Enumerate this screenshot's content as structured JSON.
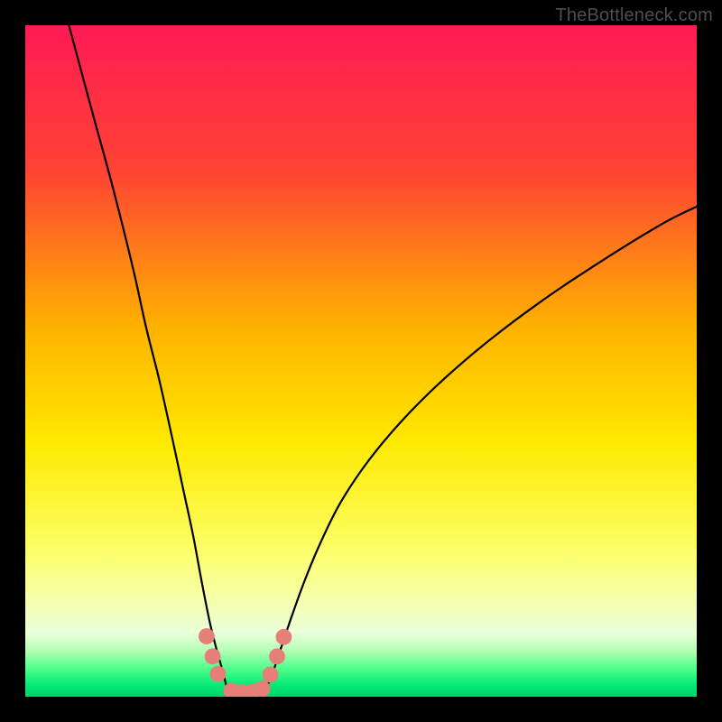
{
  "watermark": "TheBottleneck.com",
  "chart_data": {
    "type": "line",
    "title": "",
    "xlabel": "",
    "ylabel": "",
    "xlim": [
      0,
      100
    ],
    "ylim": [
      0,
      100
    ],
    "gradient_stops": [
      {
        "offset": 0.0,
        "color": "#ff1a54"
      },
      {
        "offset": 0.22,
        "color": "#ff4433"
      },
      {
        "offset": 0.45,
        "color": "#ffb200"
      },
      {
        "offset": 0.62,
        "color": "#ffe900"
      },
      {
        "offset": 0.78,
        "color": "#fcff66"
      },
      {
        "offset": 0.86,
        "color": "#f6ffb0"
      },
      {
        "offset": 0.905,
        "color": "#eaffdc"
      },
      {
        "offset": 0.93,
        "color": "#b8ffb8"
      },
      {
        "offset": 0.958,
        "color": "#4eff8a"
      },
      {
        "offset": 0.985,
        "color": "#00e877"
      },
      {
        "offset": 1.0,
        "color": "#00d46a"
      }
    ],
    "series": [
      {
        "name": "left-branch",
        "x": [
          6.5,
          10,
          13,
          16,
          18,
          20,
          22,
          23.5,
          25,
          26.3,
          27.5,
          28.5,
          29.2,
          30.3
        ],
        "y": [
          100,
          87,
          76,
          64,
          55,
          47,
          38,
          31,
          24,
          17,
          11,
          7,
          4.5,
          0.3
        ]
      },
      {
        "name": "right-branch",
        "x": [
          35.5,
          37,
          39,
          41.5,
          44,
          47,
          51,
          56,
          62,
          69,
          77,
          86,
          95,
          100
        ],
        "y": [
          0.3,
          4,
          10,
          17,
          23,
          29,
          35,
          41,
          47,
          53,
          59,
          65,
          70.5,
          73
        ]
      },
      {
        "name": "valley-floor",
        "x": [
          30.3,
          31.5,
          33,
          34.3,
          35.5
        ],
        "y": [
          0.3,
          0.1,
          0.05,
          0.1,
          0.3
        ]
      }
    ],
    "markers": {
      "name": "highlight-dots",
      "color": "#e57f78",
      "radius_pct": 1.2,
      "points": [
        {
          "x": 27.0,
          "y": 9.0
        },
        {
          "x": 27.9,
          "y": 6.0
        },
        {
          "x": 28.7,
          "y": 3.4
        },
        {
          "x": 30.7,
          "y": 0.9
        },
        {
          "x": 32.3,
          "y": 0.65
        },
        {
          "x": 33.9,
          "y": 0.75
        },
        {
          "x": 35.3,
          "y": 1.2
        },
        {
          "x": 36.5,
          "y": 3.3
        },
        {
          "x": 37.5,
          "y": 6.0
        },
        {
          "x": 38.5,
          "y": 8.9
        }
      ]
    }
  }
}
